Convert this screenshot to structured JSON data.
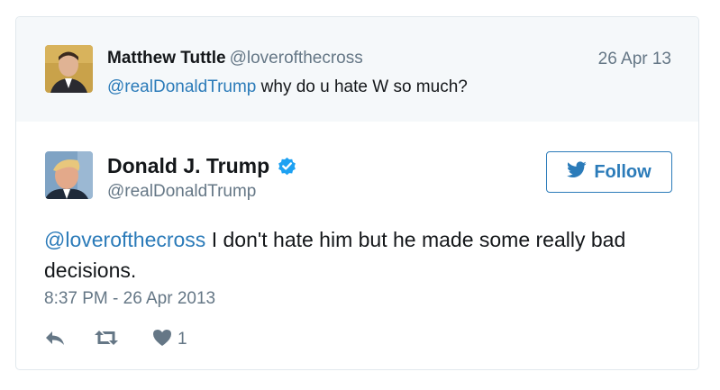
{
  "parent_tweet": {
    "name": "Matthew Tuttle",
    "handle": "@loverofthecross",
    "date": "26 Apr 13",
    "mention": "@realDonaldTrump",
    "text": " why do u hate W so much?"
  },
  "tweet": {
    "name": "Donald J. Trump",
    "handle": "@realDonaldTrump",
    "verified_icon": "verified-badge-icon",
    "follow_label": "Follow",
    "mention": "@loverofthecross",
    "text": " I don't hate him but he made some really bad decisions.",
    "timestamp": "8:37 PM - 26 Apr 2013",
    "like_count": "1"
  },
  "icons": {
    "reply": "reply-icon",
    "retweet": "retweet-icon",
    "like": "heart-icon",
    "follow": "twitter-bird-icon"
  },
  "colors": {
    "link": "#2b7bb9",
    "secondary_text": "#657786",
    "primary_text": "#14171a",
    "parent_background": "#f5f8fa",
    "verified": "#1da1f2"
  }
}
